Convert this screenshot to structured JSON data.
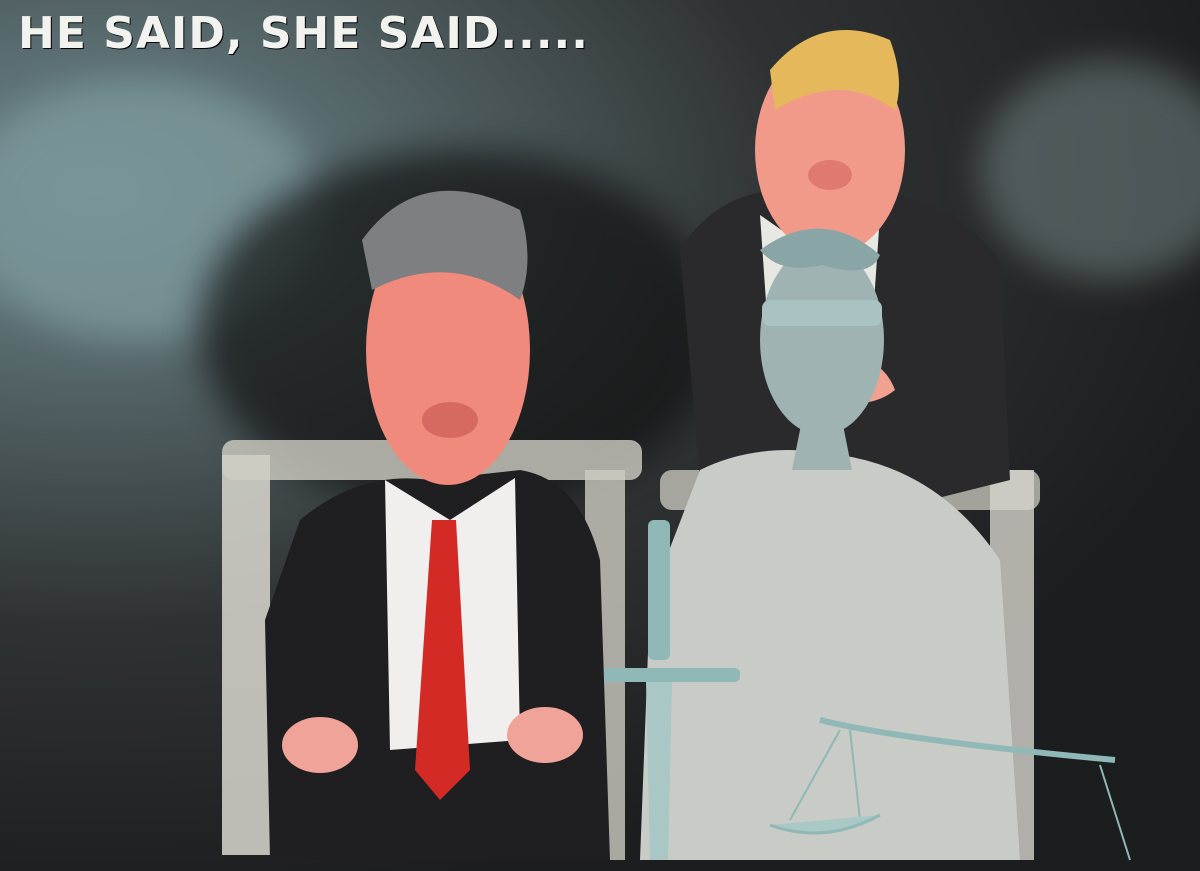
{
  "caption": {
    "text": "HE SAID, SHE SAID....."
  },
  "figures": [
    {
      "name": "seated-man",
      "suit": "#1f1f21",
      "tie": "#d32a26",
      "skin": "#f08a7c"
    },
    {
      "name": "standing-man",
      "suit": "#2a2a2c",
      "skin": "#f29a8a",
      "hair": "#e6b85c"
    },
    {
      "name": "lady-justice",
      "body": "#9fb3b3",
      "robe": "#c9cbc7",
      "metal": "#8fb8b6"
    }
  ],
  "colors": {
    "background": "#1e1f20",
    "sky_wash": "#6f8a8f",
    "chair": "#d9d8cf"
  }
}
